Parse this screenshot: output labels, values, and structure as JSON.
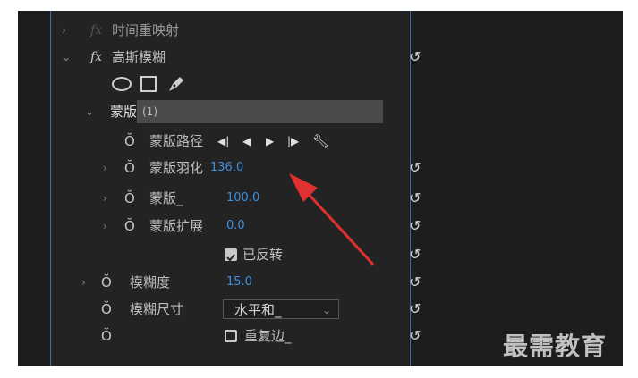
{
  "panel": {
    "rows": {
      "time_remap": {
        "label": "时间重映射"
      },
      "gaussian_blur": {
        "label": "高斯模糊"
      },
      "mask": {
        "label": "蒙版",
        "count": "(1)"
      },
      "mask_path": {
        "label": "蒙版路径"
      },
      "mask_feather": {
        "label": "蒙版羽化",
        "value": "136.0"
      },
      "mask_opacity": {
        "label": "蒙版_",
        "value": "100.0"
      },
      "mask_expansion": {
        "label": "蒙版扩展",
        "value": "0.0"
      },
      "inverted": {
        "label": "已反转",
        "checked": true
      },
      "blurriness": {
        "label": "模糊度",
        "value": "15.0"
      },
      "blur_dimensions": {
        "label": "模糊尺寸",
        "selected": "水平和_"
      },
      "repeat_edge": {
        "label": "重复边_",
        "checked": false
      }
    },
    "fx_label": "fx",
    "reset_icon": "↺"
  },
  "watermark": "最需教育",
  "colors": {
    "value_blue": "#3d8fe0",
    "arrow_red": "#e03030",
    "panel_bg": "#232323"
  }
}
